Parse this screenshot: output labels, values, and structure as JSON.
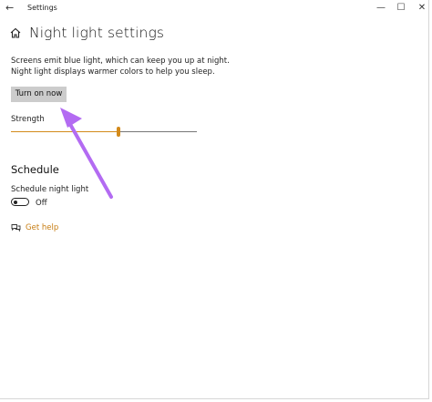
{
  "titlebar": {
    "back_icon": "back-arrow-icon",
    "app_title": "Settings",
    "minimize_glyph": "—",
    "maximize_glyph": "☐",
    "close_glyph": "✕"
  },
  "header": {
    "home_icon": "home-icon",
    "title": "Night light settings"
  },
  "description": {
    "line1": "Screens emit blue light, which can keep you up at night.",
    "line2": "Night light displays warmer colors to help you sleep."
  },
  "turn_on_button": {
    "label": "Turn on now"
  },
  "strength": {
    "label": "Strength",
    "value_fraction": 0.58
  },
  "schedule": {
    "heading": "Schedule",
    "toggle_label": "Schedule night light",
    "toggle_state": "Off"
  },
  "help": {
    "label": "Get help",
    "icon": "help-chat-icon"
  },
  "annotation": {
    "arrow_icon": "purple-pointer-arrow",
    "color": "#b36bf2"
  },
  "colors": {
    "accent": "#d38a1b",
    "link": "#c77d12",
    "button_bg": "#cccccc"
  }
}
